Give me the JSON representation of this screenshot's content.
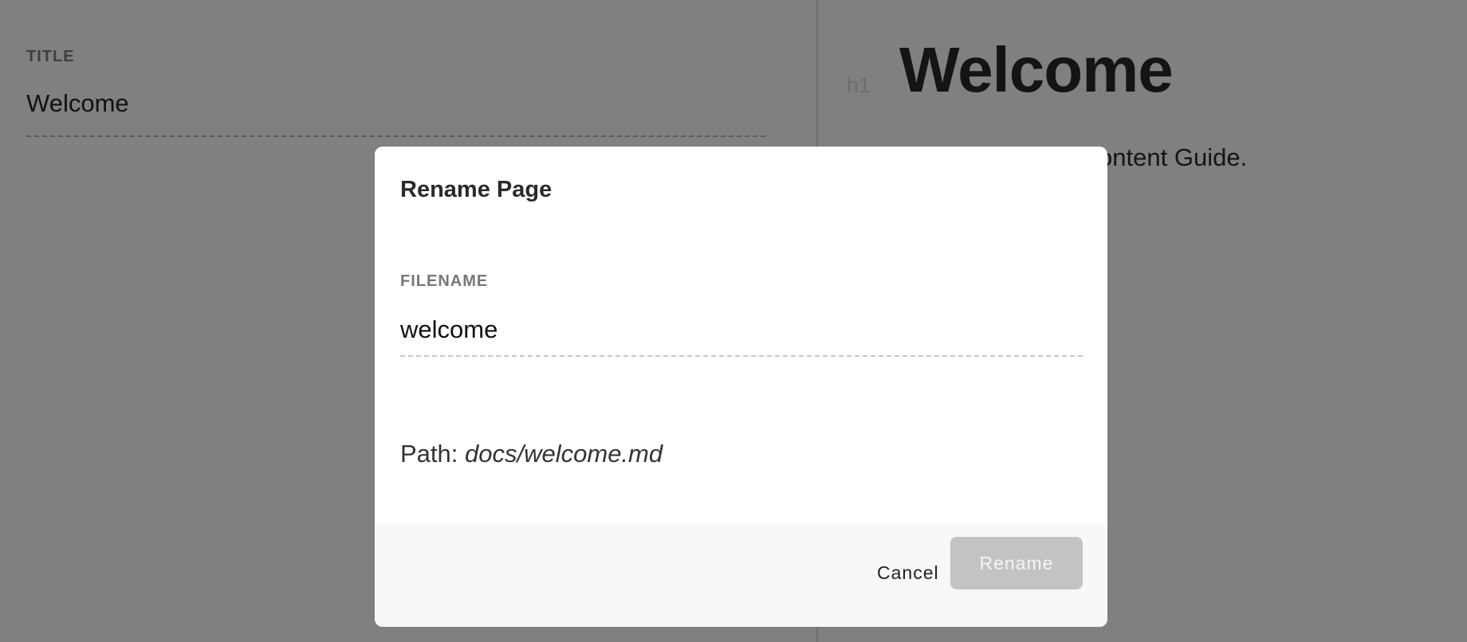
{
  "editor": {
    "title_label": "TITLE",
    "title_value": "Welcome",
    "heading_tag": "h1",
    "heading": "Welcome",
    "paragraph_visible": "Treehouse Content Guide."
  },
  "modal": {
    "title": "Rename Page",
    "filename_label": "FILENAME",
    "filename_value": "welcome",
    "path_label": "Path:",
    "path_value": "docs/welcome.md",
    "cancel_label": "Cancel",
    "rename_label": "Rename"
  }
}
